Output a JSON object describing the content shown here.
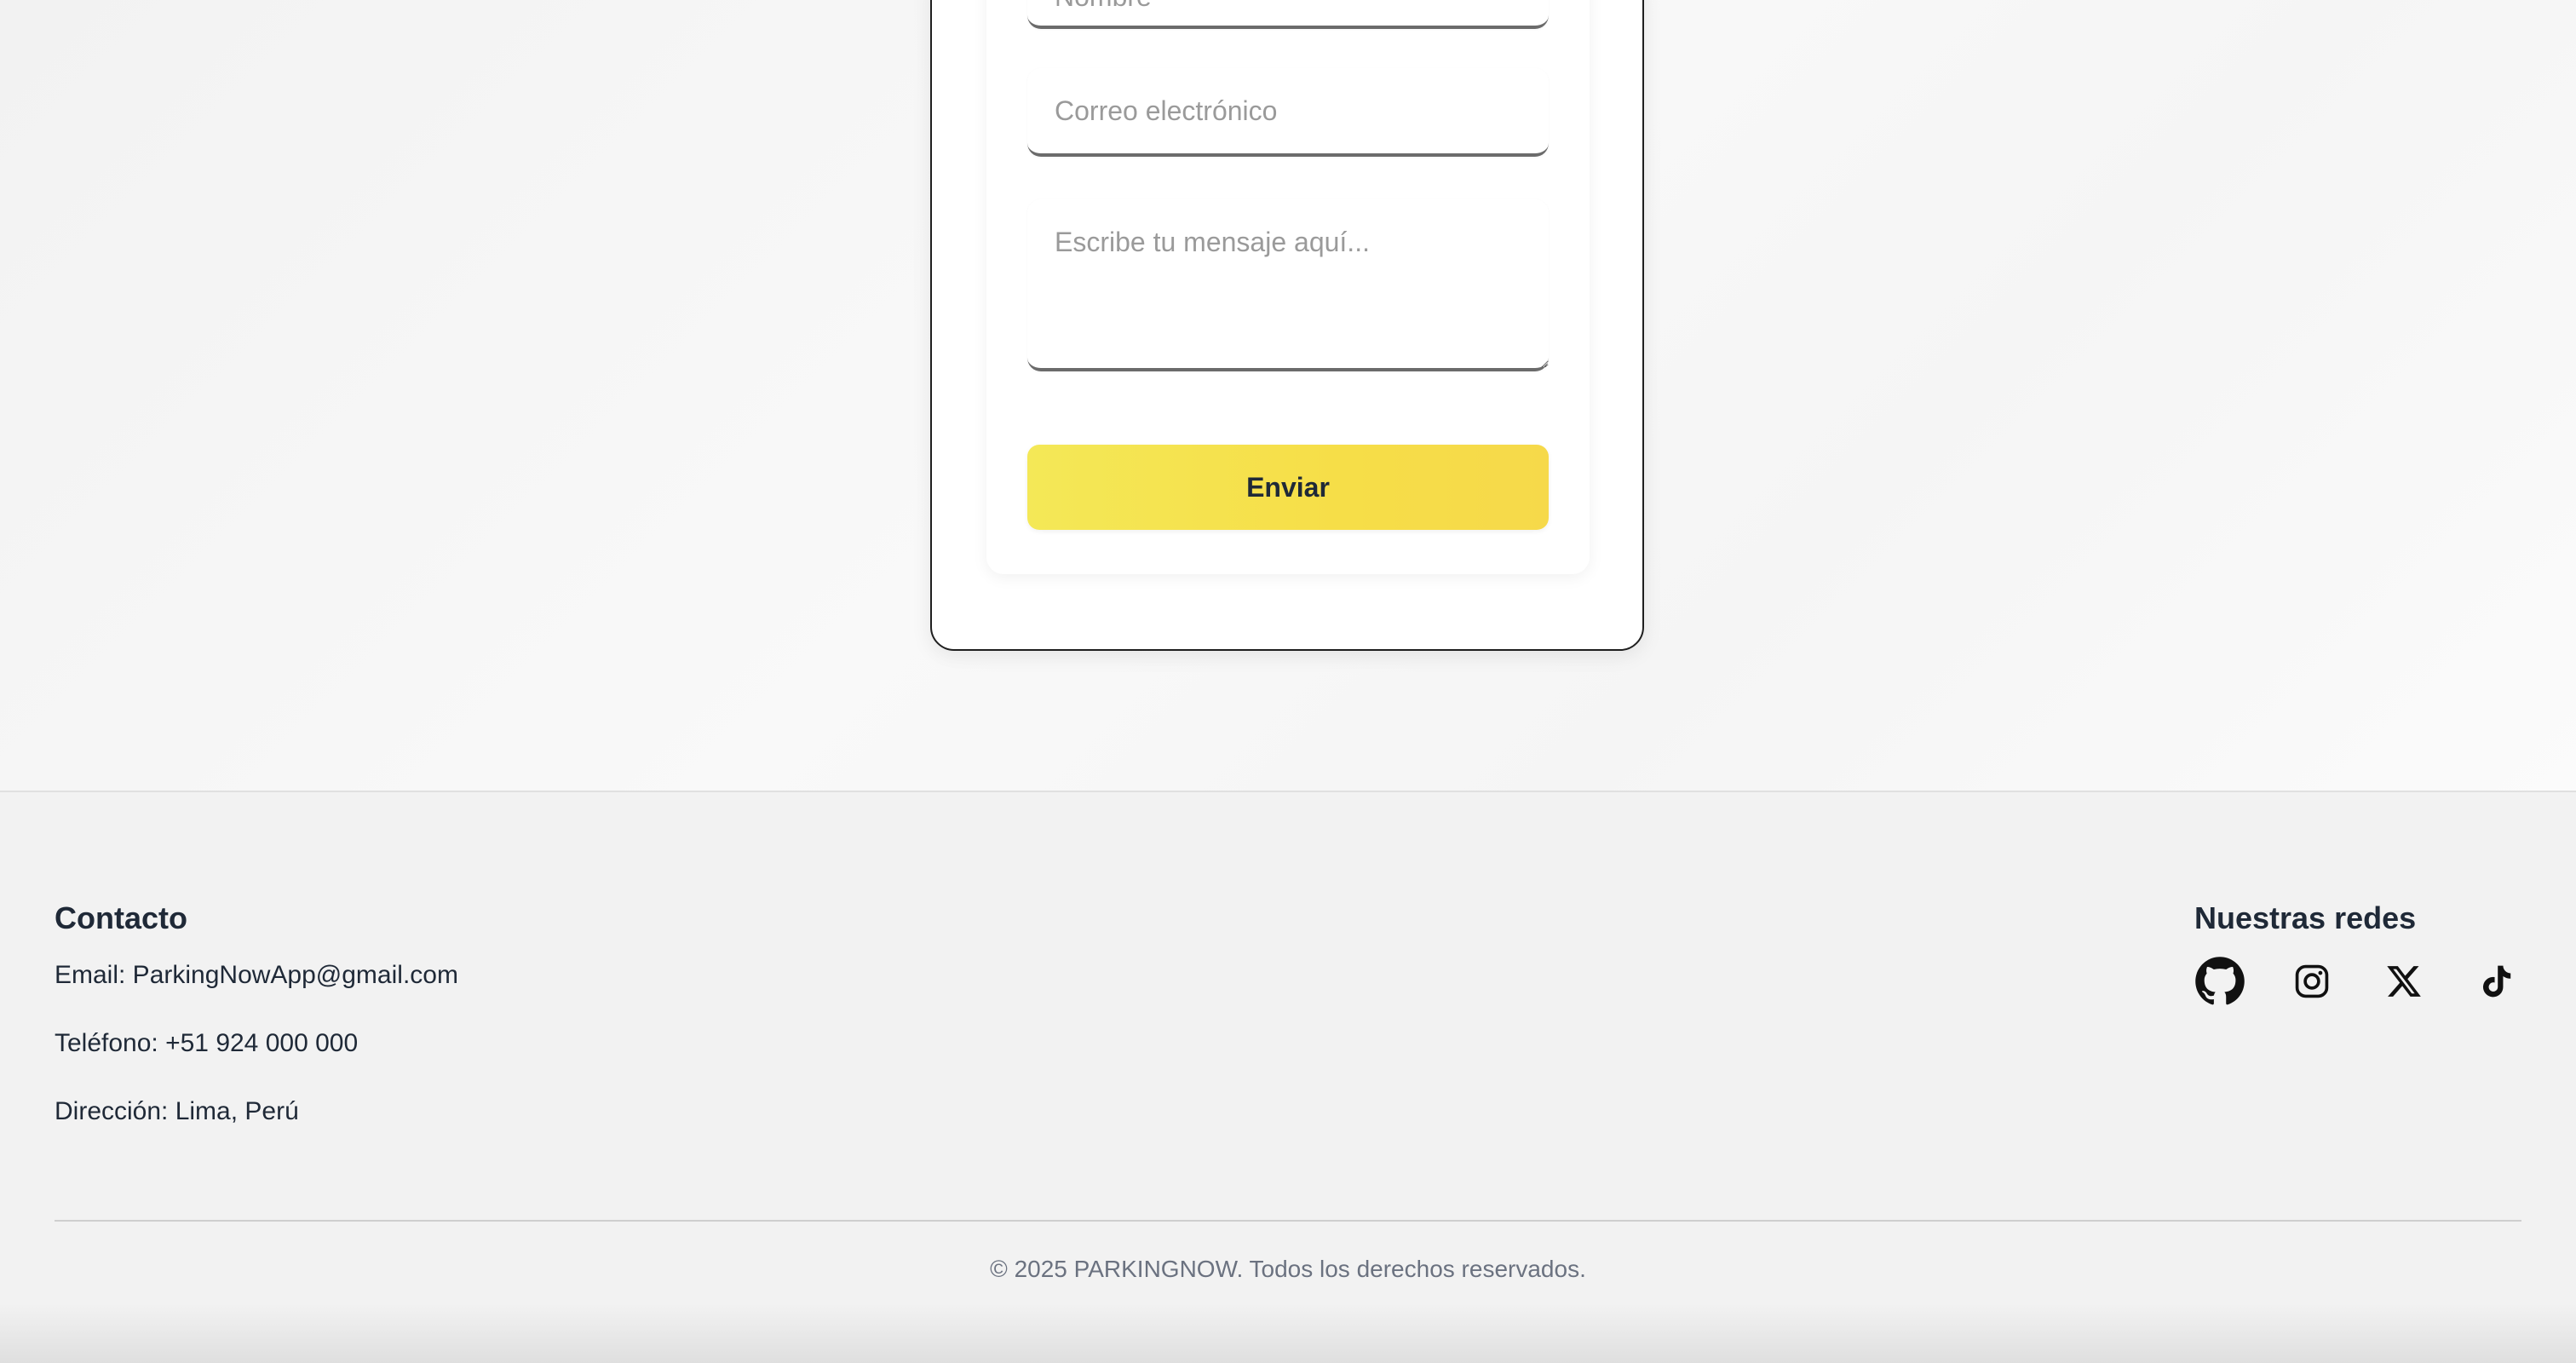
{
  "form": {
    "name_placeholder": "Nombre",
    "email_placeholder": "Correo electrónico",
    "message_placeholder": "Escribe tu mensaje aquí...",
    "submit_label": "Enviar",
    "accent_color": "#f6de48"
  },
  "footer": {
    "contact": {
      "title": "Contacto",
      "email": "Email: ParkingNowApp@gmail.com",
      "phone": "Teléfono: +51 924 000 000",
      "address": "Dirección: Lima, Perú"
    },
    "social": {
      "title": "Nuestras redes",
      "icons": [
        "github-icon",
        "instagram-icon",
        "x-icon",
        "tiktok-icon"
      ]
    },
    "copyright": "© 2025 PARKINGNOW. Todos los derechos reservados."
  }
}
